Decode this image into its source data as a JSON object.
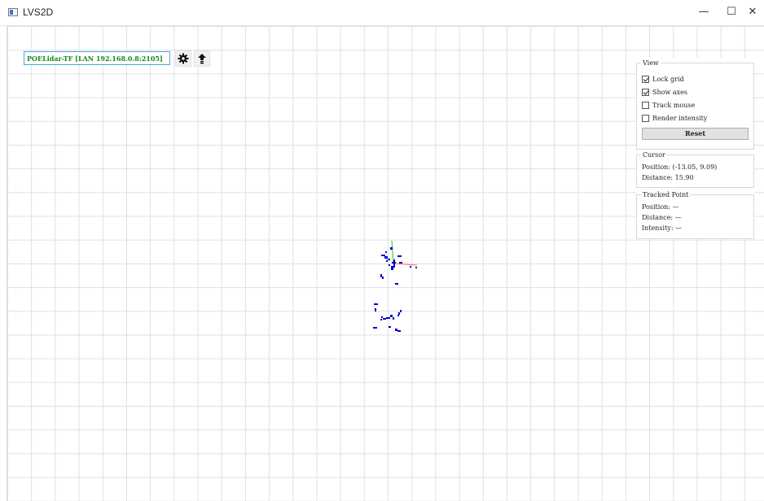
{
  "window": {
    "title": "LVS2D",
    "minimize_glyph": "—",
    "maximize_glyph": "☐",
    "close_glyph": "✕"
  },
  "toolbar": {
    "connection_label": "POELidar-TF [LAN 192.168.0.8:2105]",
    "settings_icon": "gear-icon",
    "upload_icon": "upload-icon"
  },
  "view": {
    "title": "View",
    "lock_grid": {
      "label": "Lock grid",
      "checked": true
    },
    "show_axes": {
      "label": "Show axes",
      "checked": true
    },
    "track_mouse": {
      "label": "Track mouse",
      "checked": false
    },
    "render_intensity": {
      "label": "Render intensity",
      "checked": false
    },
    "reset_label": "Reset"
  },
  "cursor": {
    "title": "Cursor",
    "position_label": "Position:",
    "position_value": "(-13.05, 9.09)",
    "distance_label": "Distance:",
    "distance_value": "15.90"
  },
  "tracked": {
    "title": "Tracked Point",
    "position_label": "Position:",
    "position_value": "—",
    "distance_label": "Distance:",
    "distance_value": "—",
    "intensity_label": "Intensity:",
    "intensity_value": "—"
  },
  "colors": {
    "scan_points": "#0000cc",
    "x_axis": "#ff6a6a",
    "y_axis": "#22cc22",
    "connection_text": "#1a8a1a",
    "connection_border": "#4fa3d6"
  }
}
